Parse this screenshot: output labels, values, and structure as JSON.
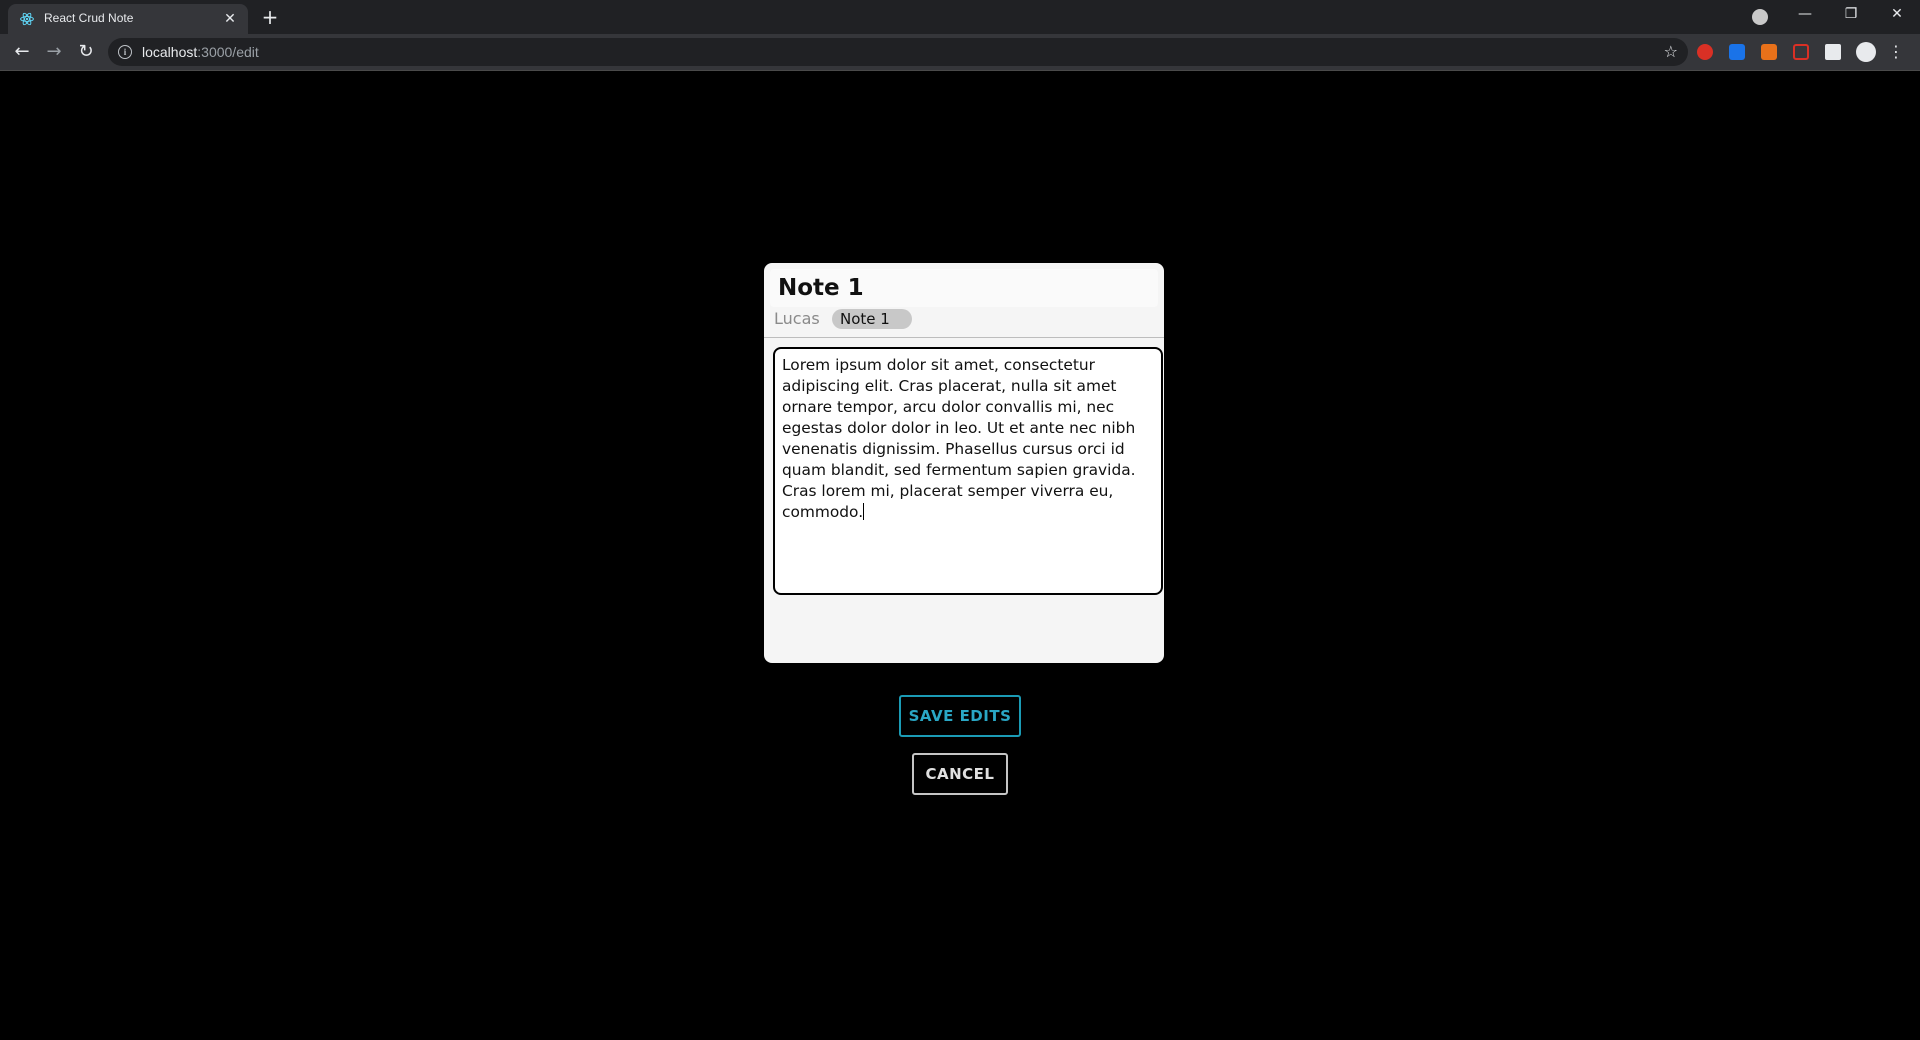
{
  "browser": {
    "tab_title": "React Crud Note",
    "close_tab_glyph": "✕",
    "new_tab_glyph": "+",
    "url_host": "localhost",
    "url_path": ":3000/edit"
  },
  "note": {
    "title": "Note 1",
    "author": "Lucas",
    "tag": "Note 1",
    "body": "Lorem ipsum dolor sit amet, consectetur adipiscing elit. Cras placerat, nulla sit amet ornare tempor, arcu dolor convallis mi, nec egestas dolor dolor in leo. Ut et ante nec nibh venenatis dignissim. Phasellus cursus orci id quam blandit, sed fermentum sapien gravida. Cras lorem mi, placerat semper viverra eu, commodo."
  },
  "actions": {
    "save_label": "SAVE EDITS",
    "cancel_label": "CANCEL"
  },
  "colors": {
    "page_background": "#000000",
    "save_accent": "#1b9bb5",
    "cancel_border": "#c5c5c5",
    "card_background": "#f5f5f5"
  }
}
